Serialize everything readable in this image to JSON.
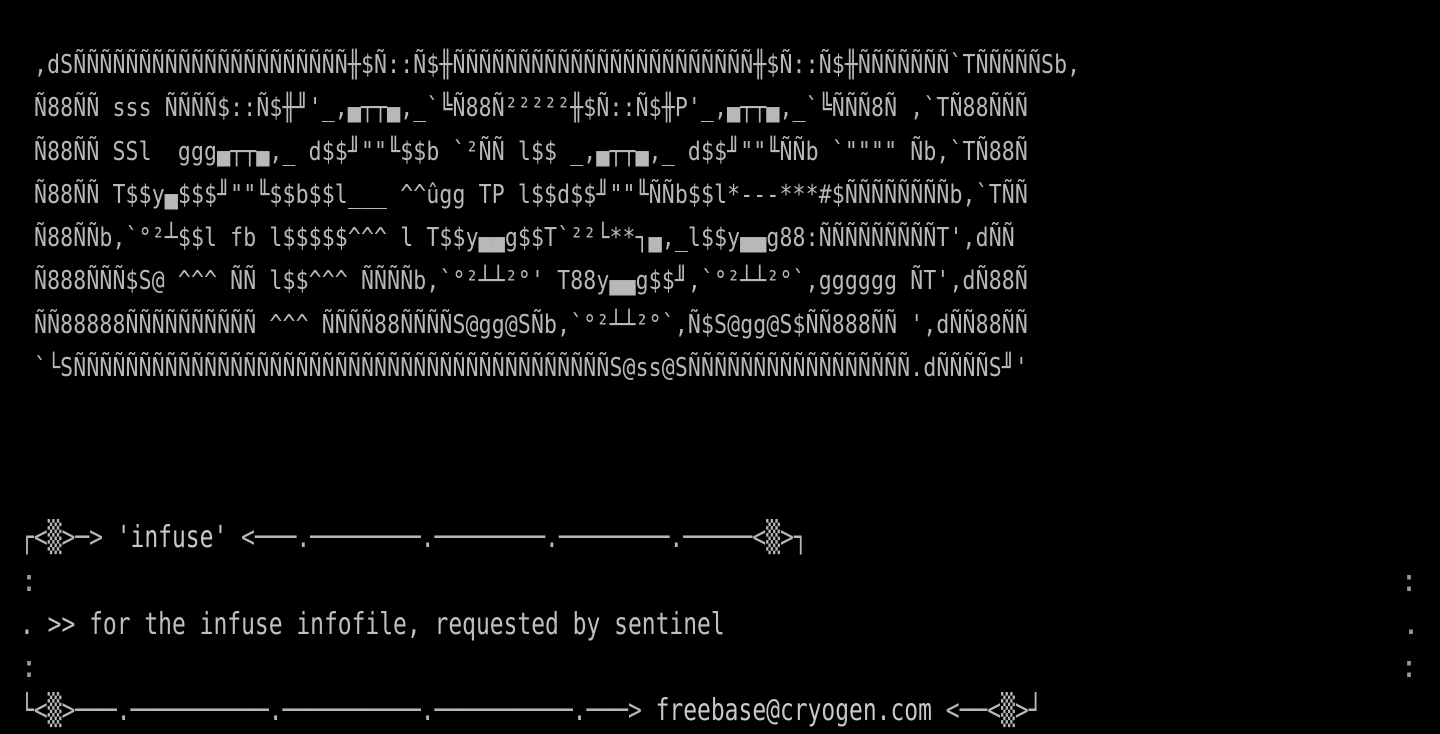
{
  "art": {
    "lines": [
      ",dSÑÑÑÑÑÑÑÑÑÑÑÑÑÑÑÑÑÑÑÑÑ╫$Ñ::Ñ$╫ÑÑÑÑÑÑÑÑÑÑÑÑÑÑÑÑÑÑÑÑÑÑÑ╫$Ñ::Ñ$╫ÑÑÑÑÑÑÑ`TÑÑÑÑÑSb,",
      "Ñ88ÑÑ sss ÑÑÑÑ$::Ñ$╫╜'_,▄┬┬▄,_`╚Ñ88Ñ²²²²²╫$Ñ::Ñ$╫P'_,▄┬┬▄,_`╚ÑÑÑ8Ñ ,`TÑ88ÑÑÑ",
      "Ñ88ÑÑ SSl  ggg▄┬┬▄,_ d$$╜\"\"╙$$b `²ÑÑ l$$ _,▄┬┬▄,_ d$$╜\"\"╙ÑÑb `\"\"\"\" Ñb,`TÑ88Ñ",
      "Ñ88ÑÑ T$$y▄$$$╜\"\"╙$$b$$l___ ^^ûgg TP l$$d$$╜\"\"╙ÑÑb$$l*---***#$ÑÑÑÑÑÑÑÑb,`TÑÑ",
      "Ñ88ÑÑb,`°²┴$$l fb l$$$$$^^^ l T$$y▄▄g$$T`²²└**┐▄,_l$$y▄▄g88:ÑÑÑÑÑÑÑÑÑT',dÑÑ",
      "Ñ888ÑÑÑ$S@ ^^^ ÑÑ l$$^^^ ÑÑÑÑb,`°²┴┴²°' T88y▄▄g$$╜,`°²┴┴²°`,gggggg ÑT',dÑ88Ñ",
      "ÑÑ88888ÑÑÑÑÑÑÑÑÑÑ ^^^ ÑÑÑÑ88ÑÑÑÑS@gg@SÑb,`°²┴┴²°`,Ñ$S@gg@S$ÑÑ888ÑÑ ',dÑÑ88ÑÑ",
      "`└SÑÑÑÑÑÑÑÑÑÑÑÑÑÑÑÑÑÑÑÑÑÑÑÑÑÑÑÑÑÑÑÑÑÑÑÑÑÑÑÑÑS@ss@SÑÑÑÑÑÑÑÑÑÑÑÑÑÑÑÑÑ.dÑÑÑÑS╜'"
    ]
  },
  "frame": {
    "top_left": "┌<▒>─> ",
    "title": "'infuse'",
    "top_right": " <───.────────.────────.────────.─────<▒>┐",
    "side_dot": ":",
    "message": ". >> for the infuse infofile, requested by sentinel",
    "message_end": ".",
    "bottom_left": "└<▒>───.──────────.──────────.──────────.───> ",
    "email": "freebase@cryogen.com",
    "bottom_right": " <──<▒>┘"
  },
  "colors": {
    "background": "#000000",
    "text": "#b8b8b8"
  }
}
